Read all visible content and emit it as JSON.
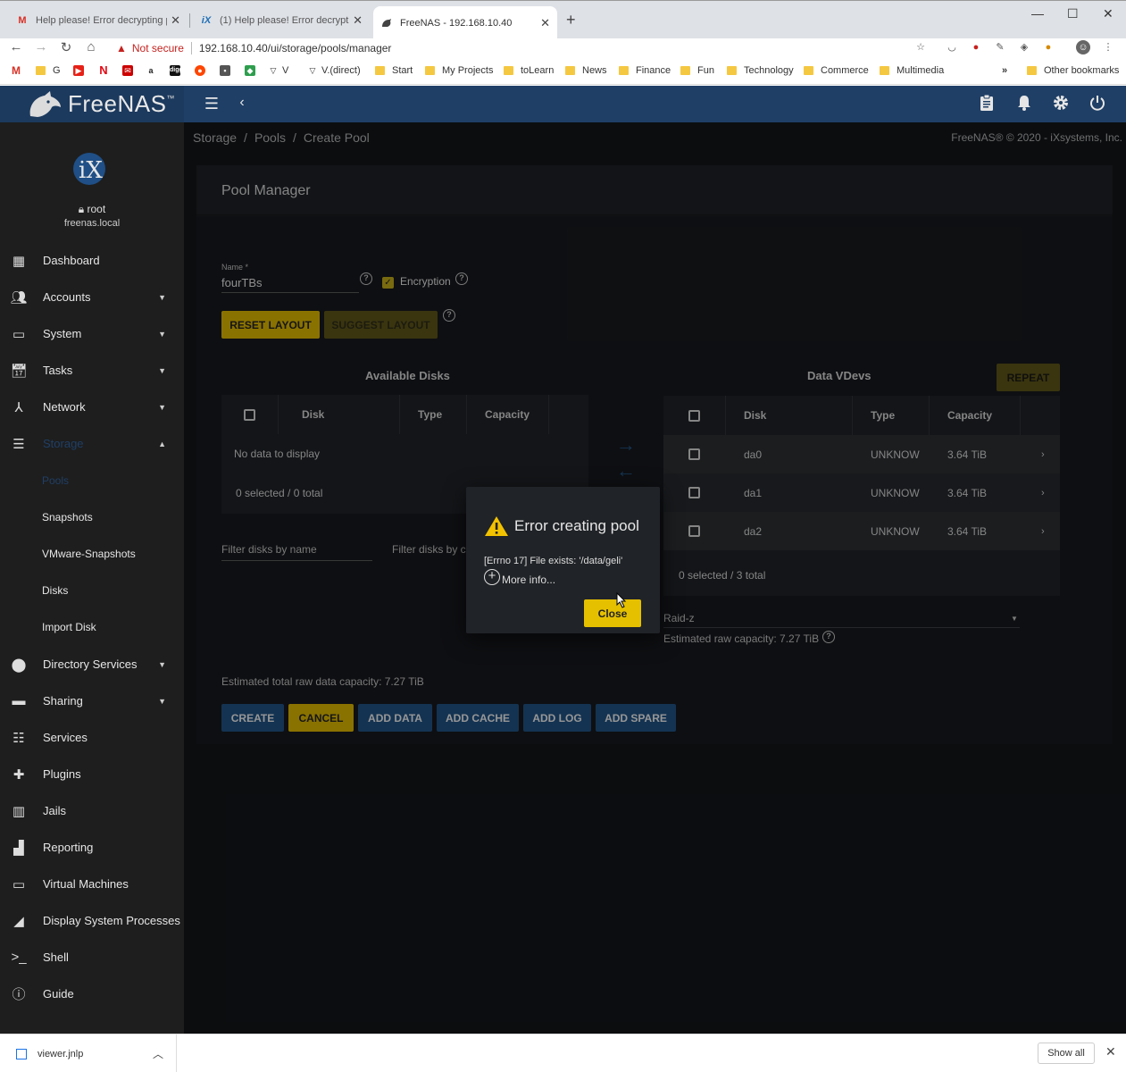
{
  "browser": {
    "tabs": [
      {
        "title": "Help please! Error decrypting po",
        "icon": "gmail-icon",
        "active": false
      },
      {
        "title": "(1) Help please! Error decrypting",
        "icon": "ix-icon",
        "active": false
      },
      {
        "title": "FreeNAS - 192.168.10.40",
        "icon": "freenas-icon",
        "active": true
      }
    ],
    "not_secure_label": "Not secure",
    "url": "192.168.10.40/ui/storage/pools/manager",
    "bookmarks": [
      {
        "label": "G",
        "type": "site"
      },
      {
        "label": "V",
        "type": "site"
      },
      {
        "label": "V.(direct)",
        "type": "site"
      },
      {
        "label": "Start",
        "type": "folder"
      },
      {
        "label": "My Projects",
        "type": "folder"
      },
      {
        "label": "toLearn",
        "type": "folder"
      },
      {
        "label": "News",
        "type": "folder"
      },
      {
        "label": "Finance",
        "type": "folder"
      },
      {
        "label": "Fun",
        "type": "folder"
      },
      {
        "label": "Technology",
        "type": "folder"
      },
      {
        "label": "Commerce",
        "type": "folder"
      },
      {
        "label": "Multimedia",
        "type": "folder"
      },
      {
        "label": "»",
        "type": "overflow"
      },
      {
        "label": "Other bookmarks",
        "type": "folder"
      }
    ]
  },
  "app": {
    "logo_text": "FreeNAS",
    "logo_tm": "™",
    "breadcrumb": [
      "Storage",
      "Pools",
      "Create Pool"
    ],
    "copyright": "FreeNAS® © 2020 - iXsystems, Inc.",
    "user": {
      "name": "root",
      "host": "freenas.local"
    }
  },
  "sidebar": {
    "items": [
      {
        "label": "Dashboard",
        "icon": "dashboard-icon",
        "has_children": false
      },
      {
        "label": "Accounts",
        "icon": "accounts-icon",
        "has_children": true
      },
      {
        "label": "System",
        "icon": "system-icon",
        "has_children": true
      },
      {
        "label": "Tasks",
        "icon": "tasks-icon",
        "has_children": true
      },
      {
        "label": "Network",
        "icon": "network-icon",
        "has_children": true
      },
      {
        "label": "Storage",
        "icon": "storage-icon",
        "has_children": true,
        "expanded": true
      },
      {
        "label": "Directory Services",
        "icon": "directory-services-icon",
        "has_children": true
      },
      {
        "label": "Sharing",
        "icon": "sharing-icon",
        "has_children": true
      },
      {
        "label": "Services",
        "icon": "services-icon",
        "has_children": false
      },
      {
        "label": "Plugins",
        "icon": "plugins-icon",
        "has_children": false
      },
      {
        "label": "Jails",
        "icon": "jails-icon",
        "has_children": false
      },
      {
        "label": "Reporting",
        "icon": "reporting-icon",
        "has_children": false
      },
      {
        "label": "Virtual Machines",
        "icon": "virtual-machines-icon",
        "has_children": false
      },
      {
        "label": "Display System Processes",
        "icon": "processes-icon",
        "has_children": false
      },
      {
        "label": "Shell",
        "icon": "shell-icon",
        "has_children": false
      },
      {
        "label": "Guide",
        "icon": "guide-icon",
        "has_children": false
      }
    ],
    "storage_sub": [
      "Pools",
      "Snapshots",
      "VMware-Snapshots",
      "Disks",
      "Import Disk"
    ]
  },
  "pool_manager": {
    "title": "Pool Manager",
    "name_label": "Name *",
    "name_value": "fourTBs",
    "encryption_label": "Encryption",
    "encryption_checked": true,
    "reset_layout": "Reset Layout",
    "suggest_layout": "Suggest Layout",
    "available_disks": {
      "title": "Available Disks",
      "columns": [
        "Disk",
        "Type",
        "Capacity"
      ],
      "empty": "No data to display",
      "footer": "0 selected / 0 total",
      "filter_name": "Filter disks by name",
      "filter_capacity": "Filter disks by c"
    },
    "data_vdevs": {
      "title": "Data VDevs",
      "repeat": "Repeat",
      "columns": [
        "Disk",
        "Type",
        "Capacity"
      ],
      "rows": [
        {
          "disk": "da0",
          "type": "UNKNOW",
          "capacity": "3.64 TiB"
        },
        {
          "disk": "da1",
          "type": "UNKNOW",
          "capacity": "3.64 TiB"
        },
        {
          "disk": "da2",
          "type": "UNKNOW",
          "capacity": "3.64 TiB"
        }
      ],
      "footer": "0 selected / 3 total",
      "layout": "Raid-z",
      "estimated": "Estimated raw capacity: 7.27 TiB"
    },
    "total_capacity": "Estimated total raw data capacity: 7.27 TiB",
    "actions": {
      "create": "Create",
      "cancel": "Cancel",
      "add_data": "Add Data",
      "add_cache": "Add Cache",
      "add_log": "Add Log",
      "add_spare": "Add Spare"
    }
  },
  "dialog": {
    "title": "Error creating pool",
    "message": "[Errno 17] File exists: '/data/geli'",
    "more_info": "More info...",
    "close": "Close"
  },
  "downloads": {
    "file": "viewer.jnlp",
    "show_all": "Show all"
  },
  "colors": {
    "topbar": "#1f3f66",
    "sidebar": "#1e1e1e",
    "accent_yellow": "#e5c000",
    "primary_blue": "#1f4f7e",
    "content_bg": "#111418"
  }
}
